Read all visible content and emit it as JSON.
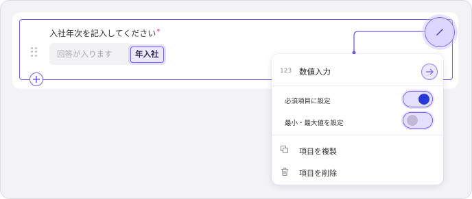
{
  "question": {
    "label": "入社年次を記入してください",
    "required_mark": "*",
    "answer_placeholder": "回答が入ります",
    "unit_badge": "年入社"
  },
  "menu": {
    "number_prefix": "123",
    "title": "数値入力",
    "settings": [
      {
        "label": "必須項目に設定",
        "enabled": true
      },
      {
        "label": "最小・最大値を設定",
        "enabled": false
      }
    ],
    "actions": [
      {
        "label": "項目を複製",
        "icon": "duplicate-icon"
      },
      {
        "label": "項目を削除",
        "icon": "trash-icon"
      }
    ]
  },
  "colors": {
    "accent": "#6d5ce8",
    "toggle_on_knob": "#2639d8",
    "required": "#e0245e"
  }
}
